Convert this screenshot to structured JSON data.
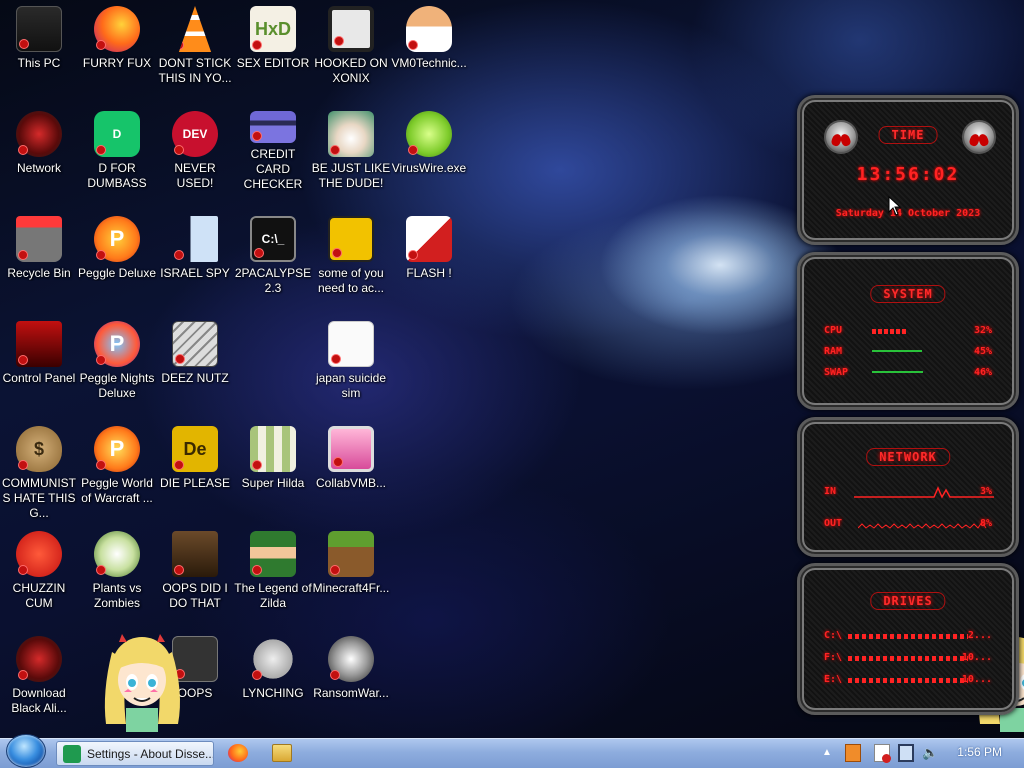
{
  "desktop_icons": [
    {
      "label": "This PC",
      "icon": "computer-icon"
    },
    {
      "label": "FURRY FUX",
      "icon": "firefox-icon"
    },
    {
      "label": "DONT STICK THIS IN YO...",
      "icon": "vlc-cone-icon"
    },
    {
      "label": "SEX EDITOR",
      "icon": "hxd-hex-editor-icon"
    },
    {
      "label": "HOOKED ON XONIX",
      "icon": "xonix-game-icon"
    },
    {
      "label": "VM0Technic...",
      "icon": "doctor-avatar-icon"
    },
    {
      "label": "Network",
      "icon": "alienware-network-icon"
    },
    {
      "label": "D FOR DUMBASS",
      "icon": "green-d-app-icon"
    },
    {
      "label": "NEVER USED!",
      "icon": "devcpp-icon"
    },
    {
      "label": "CREDIT CARD CHECKER",
      "icon": "credit-card-icon"
    },
    {
      "label": "BE JUST LIKE THE DUDE!",
      "icon": "santa-face-icon"
    },
    {
      "label": "VirusWire.exe",
      "icon": "lime-icon"
    },
    {
      "label": "Recycle Bin",
      "icon": "recycle-bin-icon"
    },
    {
      "label": "Peggle Deluxe",
      "icon": "peggle-icon"
    },
    {
      "label": "ISRAEL SPY",
      "icon": "network-spy-icon"
    },
    {
      "label": "2PACALYPSE 2.3",
      "icon": "terminal-icon"
    },
    {
      "label": "some of you need to ac...",
      "icon": "scooby-icon"
    },
    {
      "label": "FLASH !",
      "icon": "flash-icon"
    },
    {
      "label": "Control Panel",
      "icon": "control-panel-icon"
    },
    {
      "label": "Peggle Nights Deluxe",
      "icon": "peggle-nights-icon"
    },
    {
      "label": "DEEZ NUTZ",
      "icon": "windows-stack-icon"
    },
    {
      "label": "japan suicide sim",
      "icon": "japan-sim-icon"
    },
    {
      "label": "COMMUNISTS HATE THIS G...",
      "icon": "money-bag-icon"
    },
    {
      "label": "Peggle World of Warcraft ...",
      "icon": "peggle-wow-icon"
    },
    {
      "label": "DIE PLEASE",
      "icon": "dreamweaver-icon"
    },
    {
      "label": "Super Hilda",
      "icon": "pixel-art-icon"
    },
    {
      "label": "CollabVMB...",
      "icon": "monitor-icon"
    },
    {
      "label": "CHUZZIN CUM",
      "icon": "chuzzle-icon"
    },
    {
      "label": "Plants vs Zombies",
      "icon": "plants-vs-zombies-icon"
    },
    {
      "label": "OOPS DID I DO THAT",
      "icon": "portrait-icon"
    },
    {
      "label": "The Legend of Zilda",
      "icon": "zelda-sprite-icon"
    },
    {
      "label": "Minecraft4Fr...",
      "icon": "minecraft-grass-icon"
    },
    {
      "label": "Download Black Ali...",
      "icon": "alienware-download-icon"
    },
    {
      "label": "OOPS",
      "icon": "oops-icon"
    },
    {
      "label": "LYNCHING",
      "icon": "lynching-icon"
    },
    {
      "label": "RansomWar...",
      "icon": "skull-icon"
    }
  ],
  "widgets": {
    "time": {
      "title": "TIME",
      "clock": "13:56:02",
      "date": "Saturday 14 October 2023"
    },
    "system": {
      "title": "SYSTEM",
      "rows": [
        {
          "label": "CPU",
          "value": "32%",
          "fill": 0.32
        },
        {
          "label": "RAM",
          "value": "45%",
          "fill": 0.45
        },
        {
          "label": "SWAP",
          "value": "46%",
          "fill": 0.46
        }
      ]
    },
    "network": {
      "title": "NETWORK",
      "rows": [
        {
          "label": "IN",
          "value": "3%"
        },
        {
          "label": "OUT",
          "value": "8%"
        }
      ]
    },
    "drives": {
      "title": "DRIVES",
      "rows": [
        {
          "label": "C:\\",
          "value": "2..."
        },
        {
          "label": "F:\\",
          "value": "10..."
        },
        {
          "label": "E:\\",
          "value": "10..."
        }
      ]
    }
  },
  "taskbar": {
    "active_window": "Settings - About Disse...",
    "clock": "1:56 PM"
  },
  "colors": {
    "widget_red": "#ff2323",
    "taskbar": "#8eadde"
  }
}
